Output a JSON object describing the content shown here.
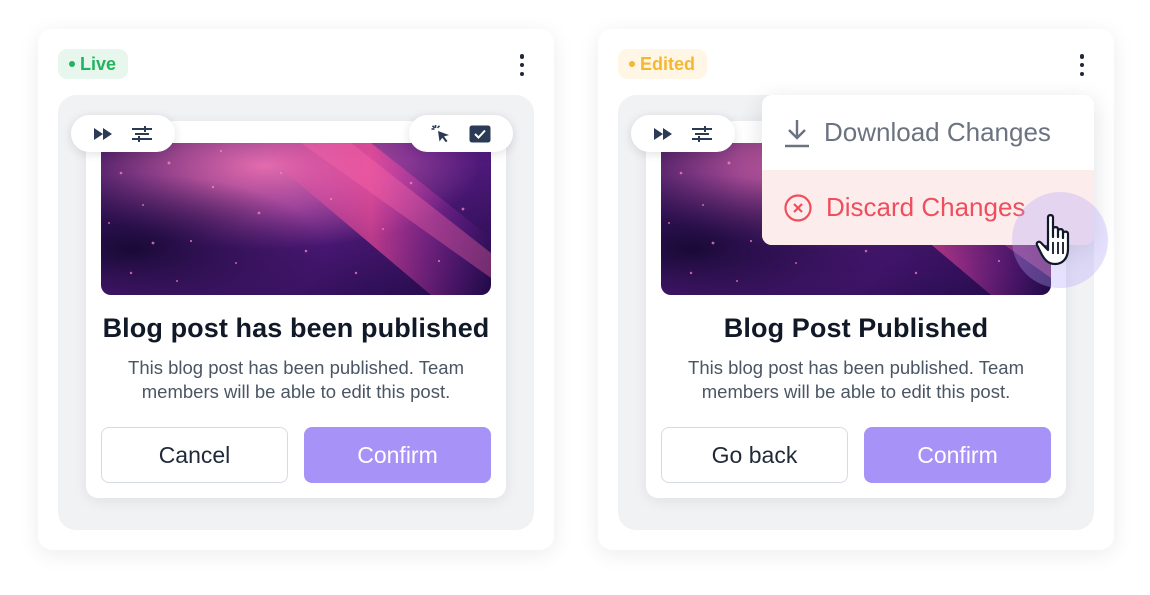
{
  "colors": {
    "live_badge_text": "#22b35e",
    "live_badge_bg": "#e8f7ee",
    "edited_badge_text": "#f5b731",
    "edited_badge_bg": "#fff6e6",
    "primary_button": "#a792f7",
    "danger_text": "#ef4e5c",
    "danger_bg": "#fdecec"
  },
  "left_panel": {
    "badge_label": "Live",
    "more_menu_icon": "vertical-dots-icon",
    "toolbar_left_icons": [
      "fast-forward-icon",
      "sliders-icon"
    ],
    "toolbar_right_icons": [
      "pointer-click-icon",
      "checkbox-icon"
    ],
    "card": {
      "image": "abstract-purple-pink-texture",
      "title": "Blog post has been published",
      "description_line1": "This blog post has been published. Team",
      "description_line2": "members will be able to edit this post.",
      "secondary_label": "Cancel",
      "primary_label": "Confirm"
    }
  },
  "right_panel": {
    "badge_label": "Edited",
    "more_menu_icon": "vertical-dots-icon",
    "toolbar_left_icons": [
      "fast-forward-icon",
      "sliders-icon"
    ],
    "card": {
      "image": "abstract-purple-pink-texture",
      "title": "Blog Post Published",
      "description_line1": "This blog post has been published. Team",
      "description_line2": "members will be able to edit this post.",
      "secondary_label": "Go back",
      "primary_label": "Confirm"
    },
    "dropdown": {
      "items": [
        {
          "label": "Download Changes",
          "icon": "download-icon"
        },
        {
          "label": "Discard Changes",
          "icon": "close-circle-icon",
          "state": "hover"
        }
      ]
    },
    "cursor_icon": "hand-pointer-icon"
  }
}
